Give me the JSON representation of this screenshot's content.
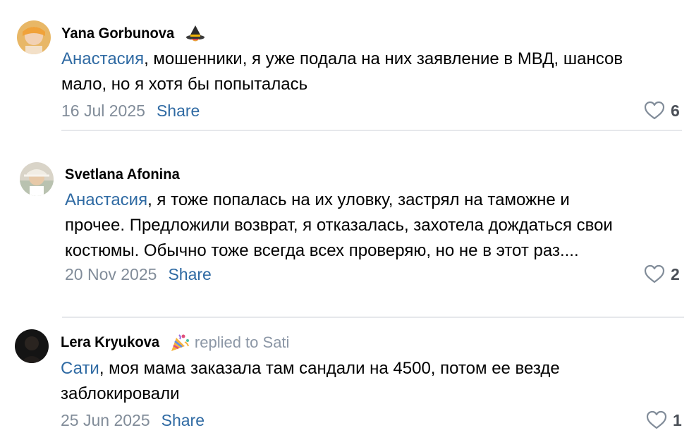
{
  "comments": [
    {
      "author": "Yana Gorbunova",
      "author_emoji": "witch-hat-emoji-icon",
      "replied_to": "",
      "mention": "Анастасия",
      "text_line1": ", мошенники, я уже подала на них заявление в МВД, шансов",
      "text_line2": "мало, но я хотя бы попыталась",
      "text_line3": "",
      "date": "16 Jul 2025",
      "share_label": "Share",
      "likes": "6"
    },
    {
      "author": "Svetlana Afonina",
      "author_emoji": "",
      "replied_to": "",
      "mention": "Анастасия",
      "text_line1": ", я тоже попалась на их уловку, застрял на таможне и",
      "text_line2": "прочее. Предложили возврат, я отказалась, захотела дождаться свои",
      "text_line3": "костюмы. Обычно тоже всегда всех проверяю, но не в этот раз....",
      "date": "20 Nov 2025",
      "share_label": "Share",
      "likes": "2"
    },
    {
      "author": "Lera Kryukova",
      "author_emoji": "party-emoji-icon",
      "replied_to": "replied to Sati",
      "mention": "Сати",
      "text_line1": ", моя мама заказала там сандали на 4500, потом ее везде",
      "text_line2": "заблокировали",
      "text_line3": "",
      "date": "25 Jun 2025",
      "share_label": "Share",
      "likes": "1"
    }
  ],
  "colors": {
    "link": "#2f6aa3",
    "meta": "#818c99",
    "replied": "#8c97a6",
    "divider": "#e6e8eb"
  }
}
